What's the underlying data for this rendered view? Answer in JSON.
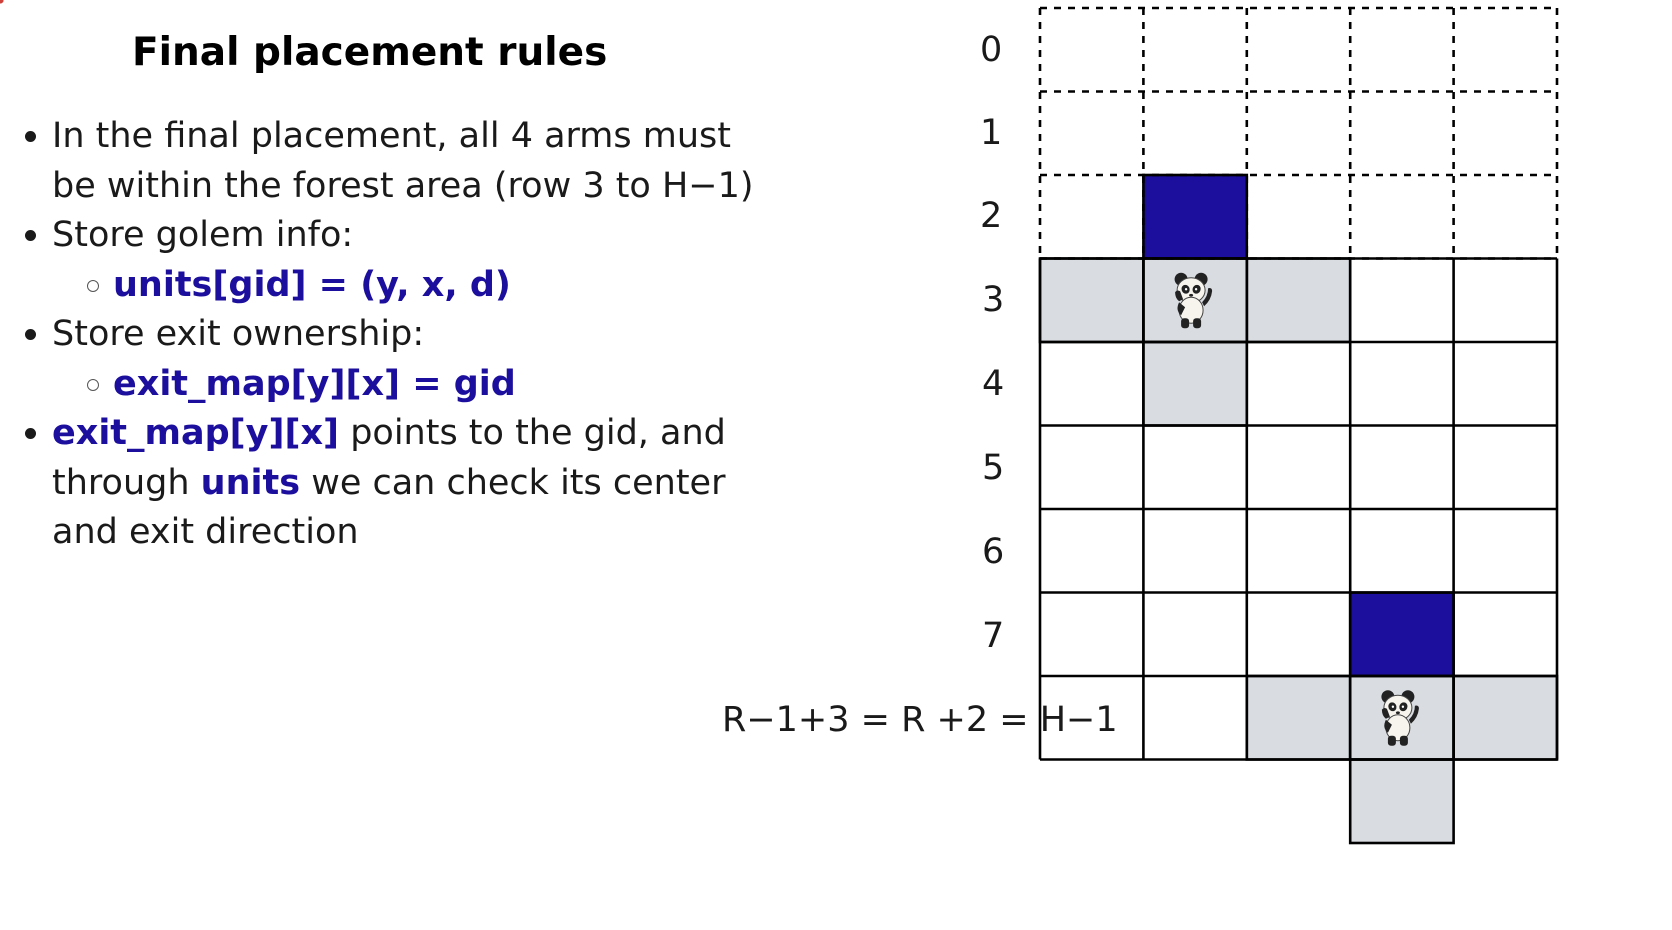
{
  "slide": {
    "title": "Final placement rules",
    "bullets": {
      "b1_line1": "In the final placement, all 4 arms must",
      "b1_line2": "be within the forest area (row 3 to H−1)",
      "b2": "Store golem info:",
      "b2_sub": "units[gid] = (y, x, d)",
      "b3": "Store exit ownership:",
      "b3_sub": "exit_map[y][x] = gid",
      "b4_code": "exit_map[y][x]",
      "b4_text1": " points to the gid, and",
      "b4_text2a": "through ",
      "b4_code2": "units",
      "b4_text2b": " we can check its center",
      "b4_text3": "and exit direction"
    }
  },
  "grid": {
    "row_labels": [
      "0",
      "1",
      "2",
      "3",
      "4",
      "5",
      "6",
      "7"
    ],
    "last_row_label": "R−1+3 = R +2 = H−1",
    "colors": {
      "arm_fill": "#d9dde1",
      "exit_fill": "#1c0f9e",
      "invalid_mark": "#d0403a",
      "grid_line": "#000000"
    },
    "golems": [
      {
        "name": "invalid-top",
        "icon": "panda-icon",
        "center": {
          "row": 3,
          "col": 1
        },
        "exit_dir": "up",
        "invalid_cell": {
          "row": 2,
          "col": 1
        }
      },
      {
        "name": "invalid-bottom",
        "icon": "panda-icon",
        "center": {
          "row": 8,
          "col": 3
        },
        "exit_dir": "up",
        "invalid_cell": {
          "row": 9,
          "col": 3
        }
      }
    ]
  }
}
